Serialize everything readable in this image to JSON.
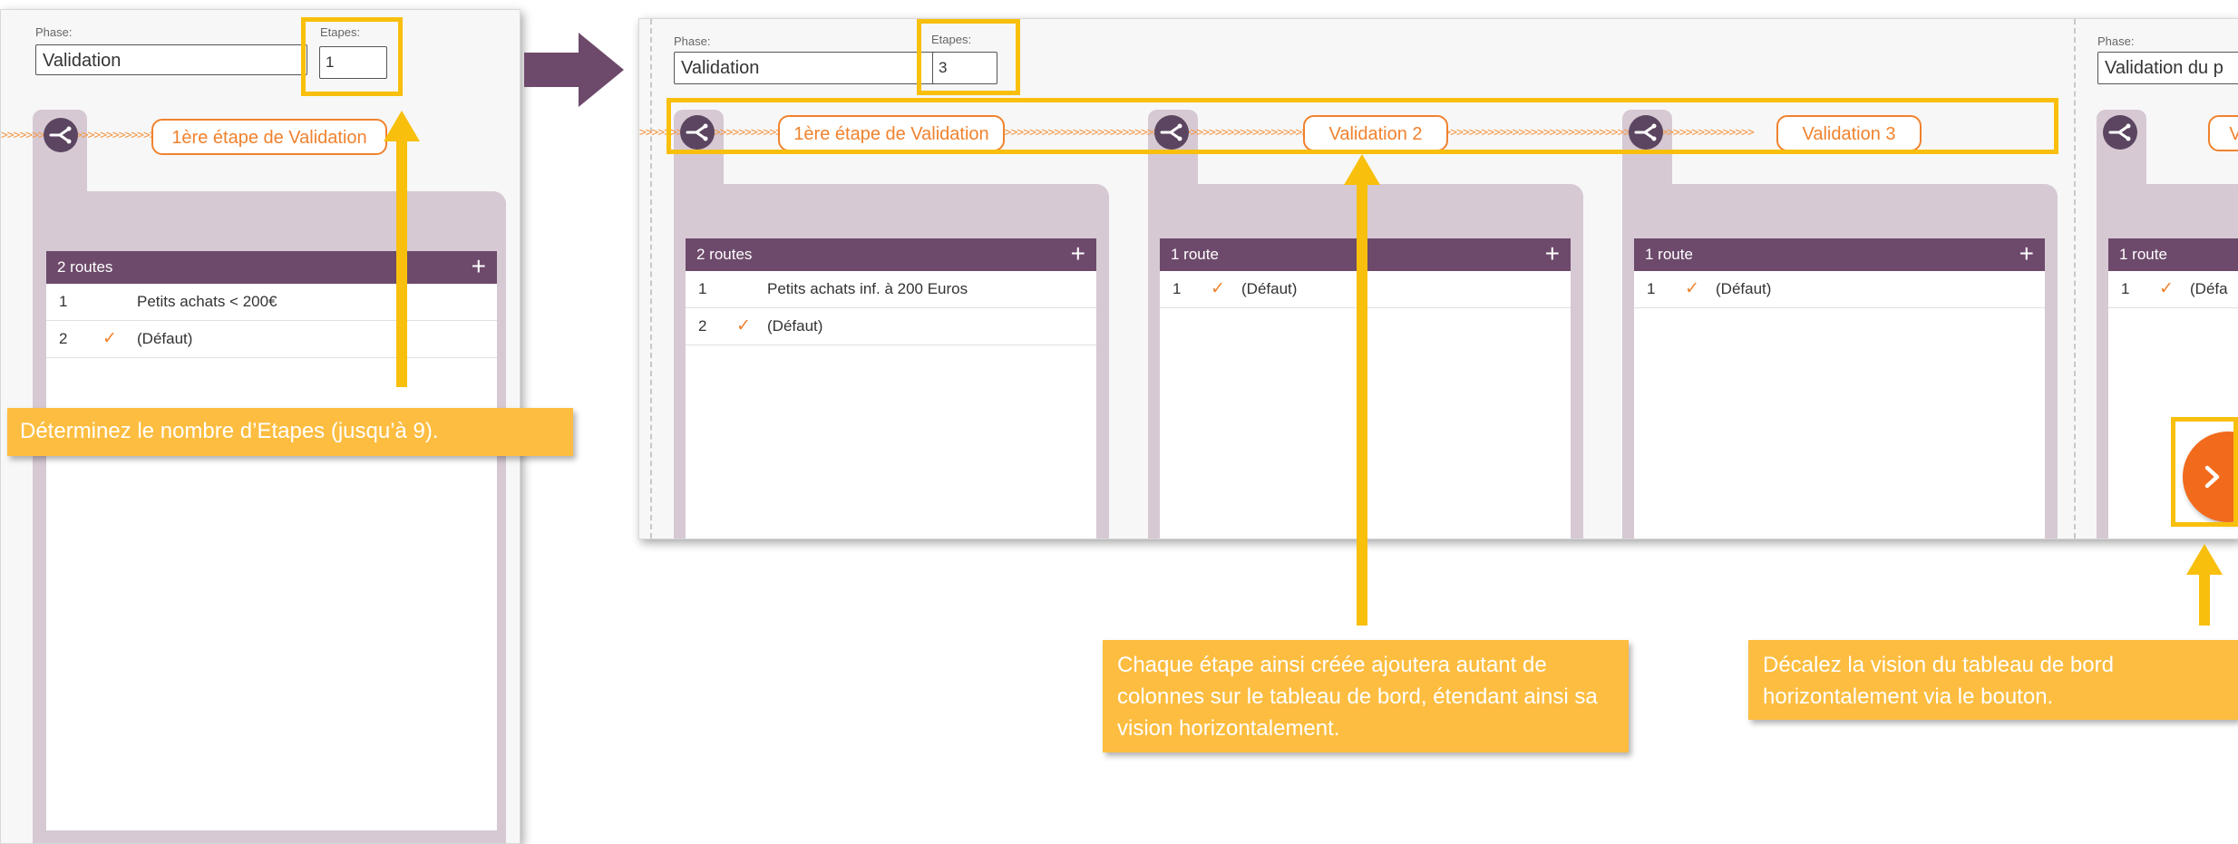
{
  "colors": {
    "accent_orange": "#f0822e",
    "header_purple": "#6d4a6b",
    "tab_lilac": "#d6c9d3",
    "highlight_yellow": "#f8bf0c",
    "callout_bg": "#fdbd40",
    "nav_arrow": "#6d4a6b"
  },
  "left_panel": {
    "phase_label": "Phase:",
    "phase_value": "Validation",
    "steps_label": "Etapes:",
    "steps_value": "1",
    "chevrons": ">>>>>>>>>>>>>>>>>>>>>>>>>>>>>>>>>>>>>>>>>>>>>>>>>>>>>>>>>>>>",
    "step": {
      "icon": "branch-icon",
      "label": "1ère étape de Validation",
      "routes_header": "2 routes",
      "add_icon": "+",
      "rows": [
        {
          "num": "1",
          "check": "",
          "text": "Petits achats < 200€"
        },
        {
          "num": "2",
          "check": "✓",
          "text": "(Défaut)"
        }
      ]
    }
  },
  "right_panel": {
    "phase_label": "Phase:",
    "phase_value": "Validation",
    "steps_label": "Etapes:",
    "steps_value": "3",
    "next_phase_label": "Phase:",
    "next_phase_value": "Validation du p",
    "chevrons": ">>>>>>>>>>>>>>>>>>>>>>>>>>>>>>>>>>>>>>>>>>>>>>>>>>>>>>>>>>>>>>>>>>>>>>>>>>>>>>>>>>>>>>>>>>>>>>>>>>>>>>>>>>>>>>>>>>>>>>>>>>>>>>>>>>>>>>>>>>>>>>>>>>>>>>>>>>>>>>>>>>>>>>>>>>>>>>>>>>>>",
    "steps": [
      {
        "label": "1ère étape de Validation",
        "routes_header": "2 routes",
        "rows": [
          {
            "num": "1",
            "check": "",
            "text": "Petits achats inf. à 200 Euros"
          },
          {
            "num": "2",
            "check": "✓",
            "text": "(Défaut)"
          }
        ]
      },
      {
        "label": "Validation 2",
        "routes_header": "1 route",
        "rows": [
          {
            "num": "1",
            "check": "✓",
            "text": "(Défaut)"
          }
        ]
      },
      {
        "label": "Validation 3",
        "routes_header": "1 route",
        "rows": [
          {
            "num": "1",
            "check": "✓",
            "text": "(Défaut)"
          }
        ]
      },
      {
        "label": "V",
        "routes_header": "1 route",
        "rows": [
          {
            "num": "1",
            "check": "✓",
            "text": "(Défa"
          }
        ]
      }
    ],
    "add_icon": "+",
    "scroll_button_icon": "chevron-right-icon"
  },
  "callouts": {
    "steps_count": "Déterminez le nombre d’Etapes (jusqu’à 9).",
    "columns": "Chaque étape ainsi créée ajoutera autant de colonnes sur le tableau de bord, étendant ainsi sa vision horizontalement.",
    "scroll": "Décalez la vision du tableau de bord horizontalement via le bouton."
  }
}
